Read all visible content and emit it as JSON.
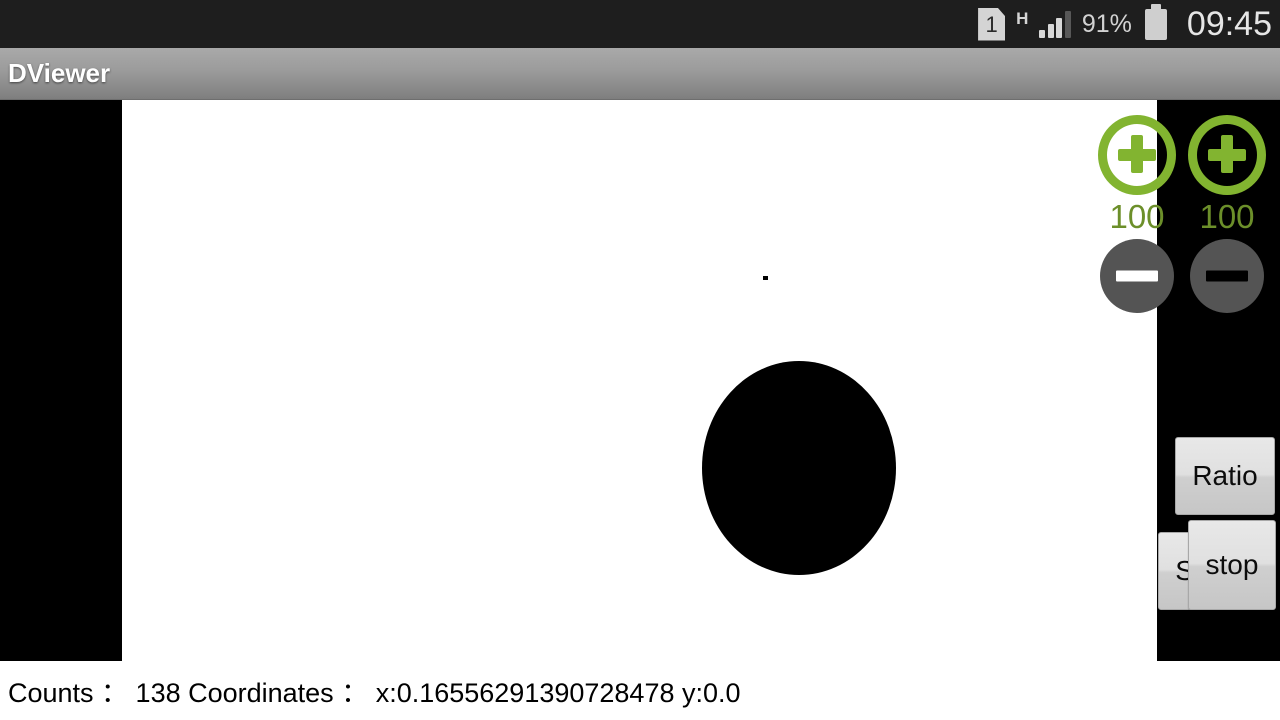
{
  "status_bar": {
    "sim_label": "1",
    "network_type": "H",
    "signal_icon": "signal-bars-icon",
    "battery_percent": "91%",
    "battery_icon": "battery-icon",
    "time": "09:45"
  },
  "title_bar": {
    "app_title": "DViewer"
  },
  "canvas": {
    "background_color": "#ffffff",
    "blob_color": "#000000"
  },
  "steppers": [
    {
      "name": "threshold-1",
      "increase_icon": "plus-circle-icon",
      "value": "100",
      "decrease_icon": "minus-circle-icon"
    },
    {
      "name": "threshold-2",
      "increase_icon": "plus-circle-icon",
      "value": "100",
      "decrease_icon": "minus-circle-icon"
    }
  ],
  "buttons": {
    "ratio": "Ratio",
    "switch": "Switch",
    "stop": "stop"
  },
  "bottom_bar": {
    "readout": "Counts ： 138 Coordinates ： x:0.16556291390728478 y:0.0",
    "counts": "138",
    "coord_x": "0.16556291390728478",
    "coord_y": "0.0"
  },
  "colors": {
    "accent_green": "#82b430",
    "value_green": "#6c8f2a",
    "minus_gray": "#545454",
    "status_bar_bg": "#1e1e1e"
  }
}
